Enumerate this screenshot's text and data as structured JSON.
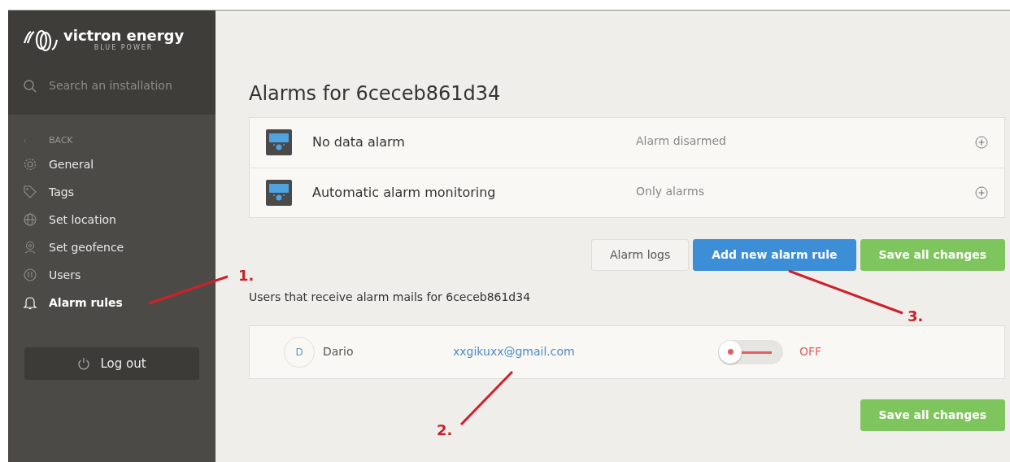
{
  "sidebar": {
    "brand": "victron energy",
    "tagline": "BLUE POWER",
    "search": {
      "placeholder": "Search an installation"
    },
    "back_label": "BACK",
    "items": [
      {
        "label": "General",
        "kind": "gear",
        "selected": false
      },
      {
        "label": "Tags",
        "kind": "tag",
        "selected": false
      },
      {
        "label": "Set location",
        "kind": "globe",
        "selected": false
      },
      {
        "label": "Set geofence",
        "kind": "pin",
        "selected": false
      },
      {
        "label": "Users",
        "kind": "users",
        "selected": false
      },
      {
        "label": "Alarm rules",
        "kind": "bell",
        "selected": true
      }
    ],
    "logout": "Log out"
  },
  "title": "Alarms for 6ceceb861d34",
  "alarms": [
    {
      "name": "No data alarm",
      "status": "Alarm disarmed"
    },
    {
      "name": "Automatic alarm monitoring",
      "status": "Only alarms"
    }
  ],
  "buttons": [
    {
      "label": "Alarm logs",
      "kind": "light"
    },
    {
      "label": "Add new alarm rule",
      "kind": "primary"
    },
    {
      "label": "Save all changes",
      "kind": "success"
    }
  ],
  "users_heading": "Users that receive alarm mails for 6ceceb861d34",
  "users": [
    {
      "initial": "D",
      "name": "Dario",
      "email": "xxgikuxx@gmail.com",
      "on": false,
      "state": "OFF"
    }
  ],
  "bottom_button": {
    "label": "Save all changes",
    "kind": "success"
  },
  "annotations": [
    {
      "label": "1."
    },
    {
      "label": "2."
    },
    {
      "label": "3."
    }
  ]
}
